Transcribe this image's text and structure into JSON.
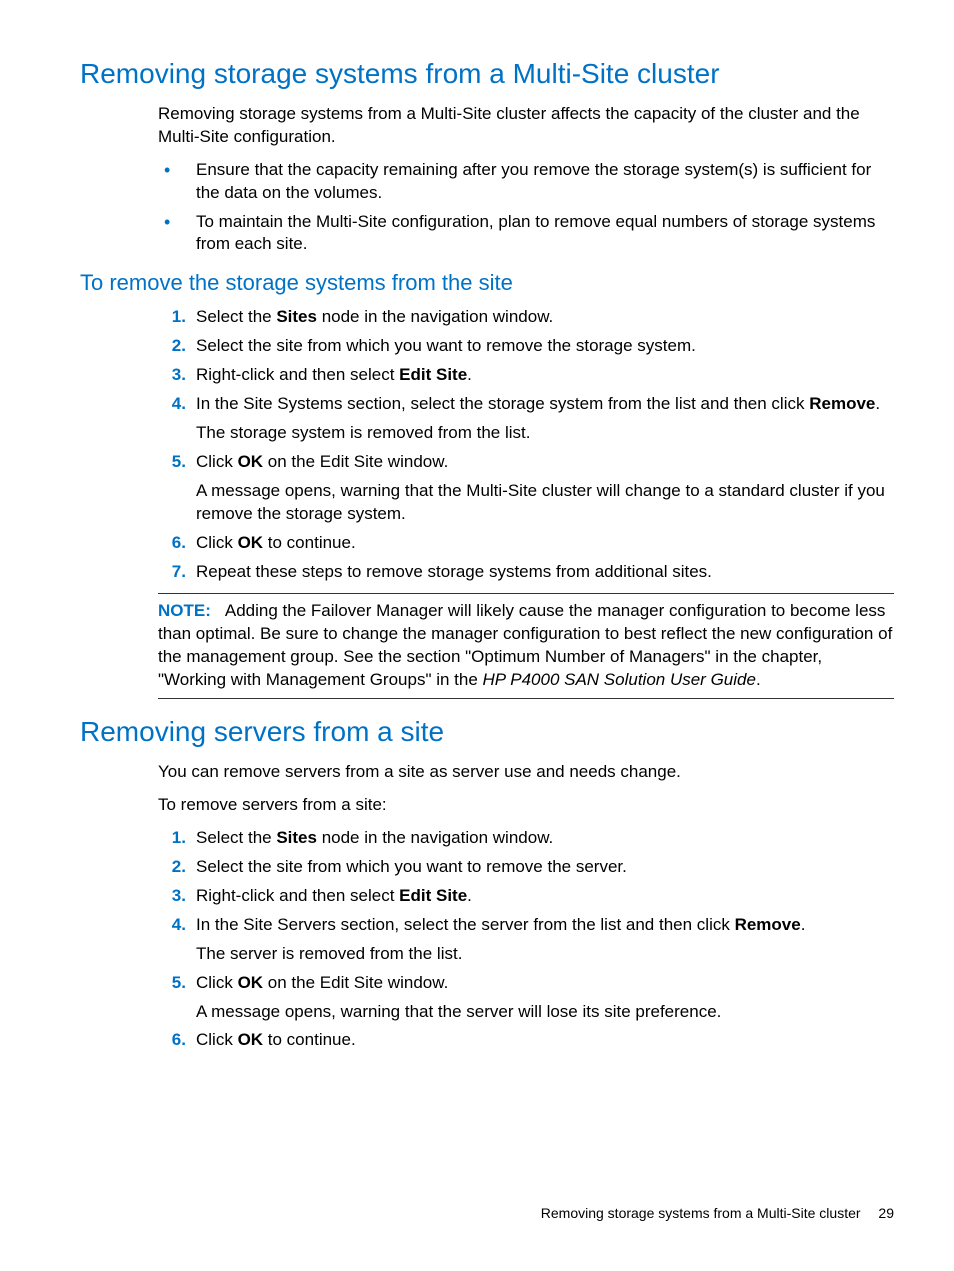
{
  "section1": {
    "title": "Removing storage systems from a Multi-Site cluster",
    "intro": "Removing storage systems from a Multi-Site cluster affects the capacity of the cluster and the Multi-Site configuration.",
    "bullets": [
      "Ensure that the capacity remaining after you remove the storage system(s) is sufficient for the data on the volumes.",
      "To maintain the Multi-Site configuration, plan to remove equal numbers of storage systems from each site."
    ],
    "sub": {
      "title": "To remove the storage systems from the site",
      "steps": {
        "s1_a": "Select the ",
        "s1_b": "Sites",
        "s1_c": " node in the navigation window.",
        "s2": "Select the site from which you want to remove the storage system.",
        "s3_a": "Right-click and then select ",
        "s3_b": "Edit Site",
        "s3_c": ".",
        "s4_a": "In the Site Systems section, select the storage system from the list and then click ",
        "s4_b": "Remove",
        "s4_c": ".",
        "s4_extra": "The storage system is removed from the list.",
        "s5_a": "Click ",
        "s5_b": "OK",
        "s5_c": " on the Edit Site window.",
        "s5_extra": "A message opens, warning that the Multi-Site cluster will change to a standard cluster if you remove the storage system.",
        "s6_a": "Click ",
        "s6_b": "OK",
        "s6_c": " to continue.",
        "s7": "Repeat these steps to remove storage systems from additional sites."
      },
      "note_label": "NOTE:",
      "note_a": "Adding the Failover Manager will likely cause the manager configuration to become less than optimal. Be sure to change the manager configuration to best reflect the new configuration of the management group. See the section \"Optimum Number of Managers\" in the chapter, \"Working with Management Groups\" in the ",
      "note_i": "HP P4000 SAN Solution User Guide",
      "note_b": "."
    }
  },
  "section2": {
    "title": "Removing servers from a site",
    "intro": "You can remove servers from a site as server use and needs change.",
    "lead": "To remove servers from a site:",
    "steps": {
      "s1_a": "Select the ",
      "s1_b": "Sites",
      "s1_c": " node in the navigation window.",
      "s2": "Select the site from which you want to remove the server.",
      "s3_a": "Right-click and then select ",
      "s3_b": "Edit Site",
      "s3_c": ".",
      "s4_a": "In the Site Servers section, select the server from the list and then click ",
      "s4_b": "Remove",
      "s4_c": ".",
      "s4_extra": "The server is removed from the list.",
      "s5_a": "Click ",
      "s5_b": "OK",
      "s5_c": " on the Edit Site window.",
      "s5_extra": "A message opens, warning that the server will lose its site preference.",
      "s6_a": "Click ",
      "s6_b": "OK",
      "s6_c": " to continue."
    }
  },
  "footer": {
    "text": "Removing storage systems from a Multi-Site cluster",
    "page": "29"
  }
}
